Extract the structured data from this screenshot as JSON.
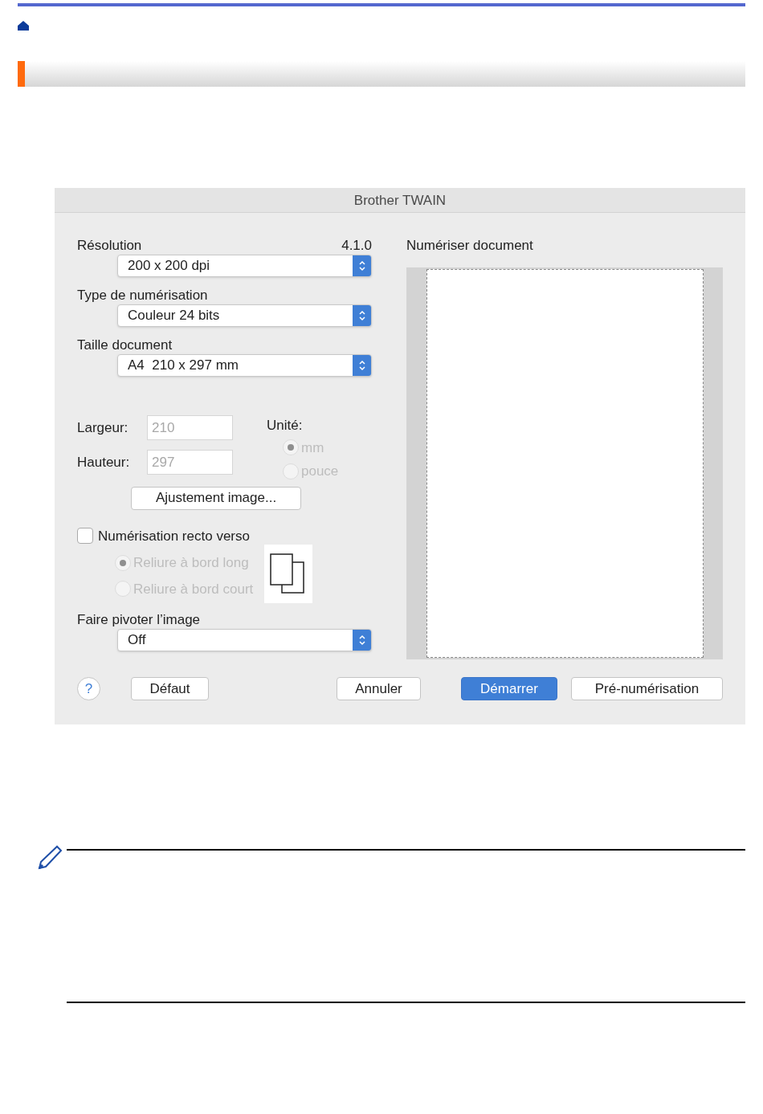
{
  "dialog": {
    "title": "Brother TWAIN",
    "version": "4.1.0",
    "popups": [
      {
        "label": "Résolution",
        "value": "200 x 200 dpi"
      },
      {
        "label": "Type de numérisation",
        "value": "Couleur 24 bits"
      },
      {
        "label": "Taille document",
        "value": "A4  210 x 297 mm"
      }
    ],
    "size_fields": [
      {
        "label": "Largeur:",
        "value": "210",
        "disabled": true
      },
      {
        "label": "Hauteur:",
        "value": "297",
        "disabled": true
      }
    ],
    "unit": {
      "label": "Unité:",
      "options": [
        {
          "label": "mm",
          "selected": true,
          "disabled": true
        },
        {
          "label": "pouce",
          "selected": false,
          "disabled": true
        }
      ]
    },
    "adjust_button": "Ajustement image...",
    "duplex": {
      "label": "Numérisation recto verso",
      "checked": false,
      "options": [
        {
          "label": "Reliure à bord long",
          "selected": true,
          "disabled": true
        },
        {
          "label": "Reliure à bord court",
          "selected": false,
          "disabled": true
        }
      ]
    },
    "rotate": {
      "label": "Faire pivoter l’image",
      "value": "Off"
    },
    "preview_title": "Numériser document",
    "help": "?",
    "buttons": [
      {
        "label": "Défaut",
        "kind": "normal"
      },
      {
        "label": "Annuler",
        "kind": "normal"
      },
      {
        "label": "Démarrer",
        "kind": "primary"
      },
      {
        "label": "Pré-numérisation",
        "kind": "normal"
      }
    ]
  }
}
